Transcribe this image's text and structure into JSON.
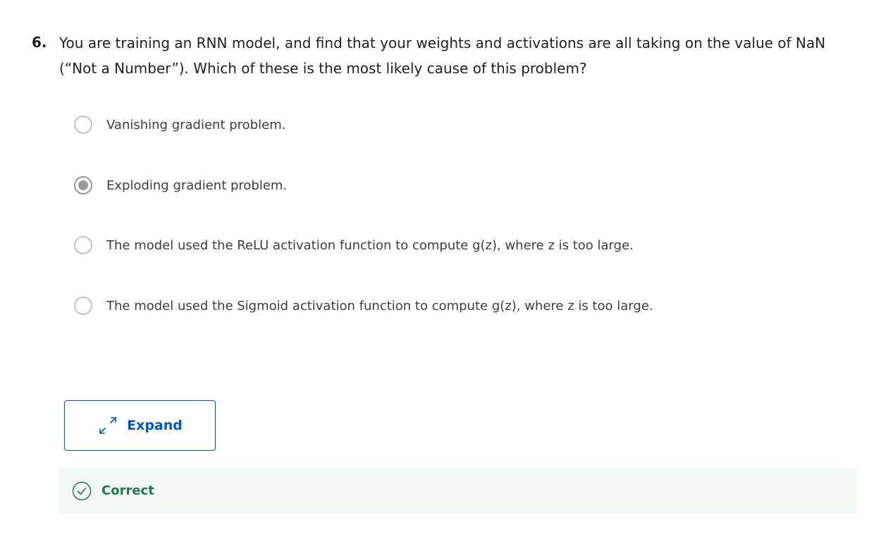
{
  "question": {
    "number": "6.",
    "text": "You are training an RNN model, and find that your weights and activations are all taking on the value of NaN (“Not a Number”). Which of these is the most likely cause of this problem?"
  },
  "options": [
    {
      "label": "Vanishing gradient problem.",
      "selected": false
    },
    {
      "label": "Exploding gradient problem.",
      "selected": true
    },
    {
      "label": "The model used the ReLU activation function to compute g(z), where z is too large.",
      "selected": false
    },
    {
      "label": "The model used the Sigmoid activation function to compute g(z), where z is too large.",
      "selected": false
    }
  ],
  "expand": {
    "label": "Expand",
    "icon": "expand-arrows-icon"
  },
  "feedback": {
    "label": "Correct",
    "icon": "check-circle-icon"
  },
  "colors": {
    "accent": "#0056d2",
    "correct": "#1f7a4f",
    "feedback_bg": "#f3f8f5"
  }
}
